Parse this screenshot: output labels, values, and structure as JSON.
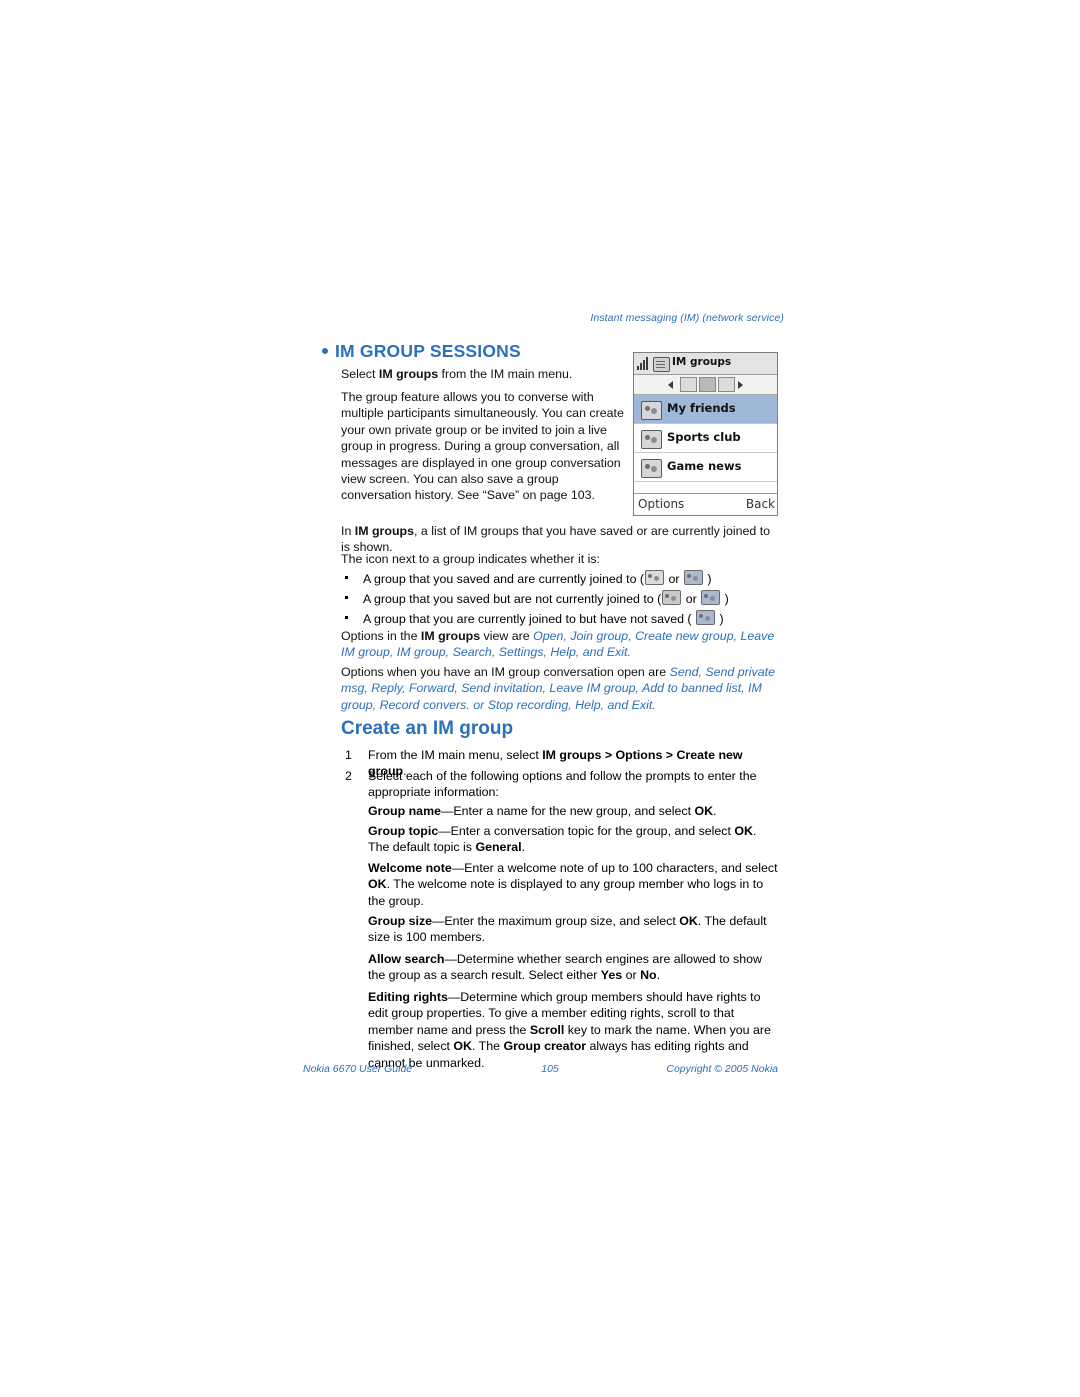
{
  "running_head": "Instant messaging (IM) (network service)",
  "section": {
    "heading": "IM GROUP SESSIONS",
    "p1": "Select IM groups from the IM main menu.",
    "p1_bold": "IM groups",
    "p2": "The group feature allows you to converse with multiple participants simultaneously. You can create your own private group or be invited to join a live group in progress. During a group conversation, all messages are displayed in one group conversation view screen. You can also save a group conversation history. See “Save” on page 103.",
    "p3_pre": "In ",
    "p3_bold": "IM groups",
    "p3_post": ", a list of IM groups that you have saved or are currently joined to is shown.",
    "p4": "The icon next to a group indicates whether it is:",
    "bullets": [
      "A group that you saved and are currently joined to (  or  )",
      "A group that you saved but are not currently joined to (  or  )",
      "A group that you are currently joined to but have not saved (  )"
    ],
    "bullet1_a": "A group that you saved and are currently joined to (",
    "bullet1_or": "or",
    "bullet1_b": ")",
    "bullet2_a": "A group that you saved but are not currently joined to (",
    "bullet2_or": "or",
    "bullet2_b": ")",
    "bullet3_a": "A group that you are currently joined to but have not saved (",
    "bullet3_b": ")",
    "options_line1_a": "Options in the ",
    "options_line1_bold": "IM groups",
    "options_line1_b": " view are ",
    "options_items_1": "Open, Join group, Create new group, Leave IM group, IM group, Search, Settings, Help, and Exit.",
    "options_line2_a": "Options when you have an IM group conversation open are ",
    "options_items_2": "Send, Send private msg, Reply, Forward, Send invitation, Leave IM group, Add to banned list, IM group, Record convers. or Stop recording, Help, and Exit."
  },
  "subsection": {
    "heading": "Create an IM group",
    "steps": [
      {
        "num": "1",
        "text_a": "From the IM main menu, select ",
        "text_bold": "IM groups > Options > Create new group",
        "text_b": "."
      },
      {
        "num": "2",
        "text_a": "Select each of the following options and follow the prompts to enter the appropriate information:",
        "text_bold": "",
        "text_b": ""
      }
    ],
    "fields": [
      {
        "label": "Group name",
        "text": "—Enter a name for the new group, and select ",
        "bold_tail": "OK",
        "tail": "."
      },
      {
        "label": "Group topic",
        "text": "—Enter a conversation topic for the group, and select ",
        "bold_tail": "OK",
        "tail": ". The default topic is ",
        "bold_tail2": "General",
        "tail2": "."
      },
      {
        "label": "Welcome note",
        "text": "—Enter a welcome note of up to 100 characters, and select ",
        "bold_tail": "OK",
        "tail": ". The welcome note is displayed to any group member who logs in to the group."
      },
      {
        "label": "Group size",
        "text": "—Enter the maximum group size, and select ",
        "bold_tail": "OK",
        "tail": ". The default size is 100 members."
      },
      {
        "label": "Allow search",
        "text": "—Determine whether search engines are allowed to show the group as a search result. Select either ",
        "bold_tail": "Yes",
        "tail": " or ",
        "bold_tail2": "No",
        "tail2": "."
      },
      {
        "label": "Editing rights",
        "text": "—Determine which group members should have rights to edit group properties. To give a member editing rights, scroll to that member name and press the ",
        "bold_tail": "Scroll",
        "tail": " key to mark the name. When you are finished, select ",
        "bold_tail2": "OK",
        "tail2": ". The ",
        "bold_tail3": "Group creator",
        "tail3": " always has editing rights and cannot be unmarked."
      }
    ]
  },
  "phone": {
    "title": "IM groups",
    "list": [
      {
        "label": "My friends",
        "selected": true
      },
      {
        "label": "Sports club",
        "selected": false
      },
      {
        "label": "Game news",
        "selected": false
      }
    ],
    "softkey_left": "Options",
    "softkey_right": "Back"
  },
  "footer": {
    "left": "Nokia 6670 User Guide",
    "center": "105",
    "right": "Copyright © 2005 Nokia"
  },
  "colors": {
    "accent": "#2c6fbb",
    "text": "#111111"
  }
}
